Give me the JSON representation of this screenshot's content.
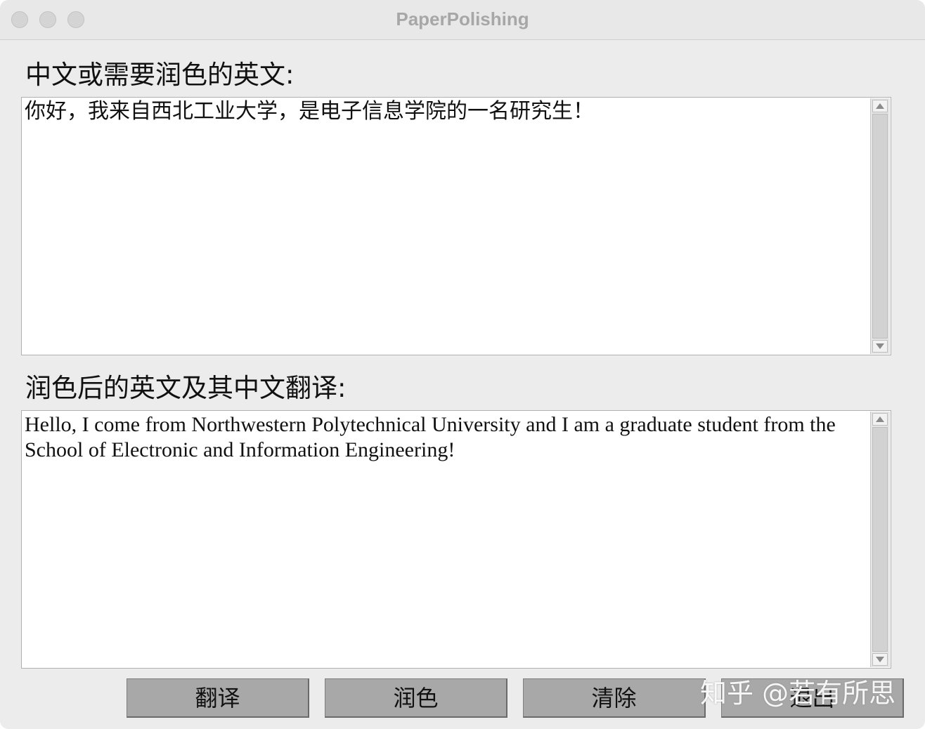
{
  "window": {
    "title": "PaperPolishing"
  },
  "input_section": {
    "label": "中文或需要润色的英文:",
    "text": "你好，我来自西北工业大学，是电子信息学院的一名研究生！"
  },
  "output_section": {
    "label": "润色后的英文及其中文翻译:",
    "text": "Hello, I come from Northwestern Polytechnical University and I am a graduate student from the School of Electronic and Information Engineering!"
  },
  "buttons": {
    "translate": "翻译",
    "polish": "润色",
    "clear": "清除",
    "exit": "退出"
  },
  "watermark": "知乎 @若有所思"
}
